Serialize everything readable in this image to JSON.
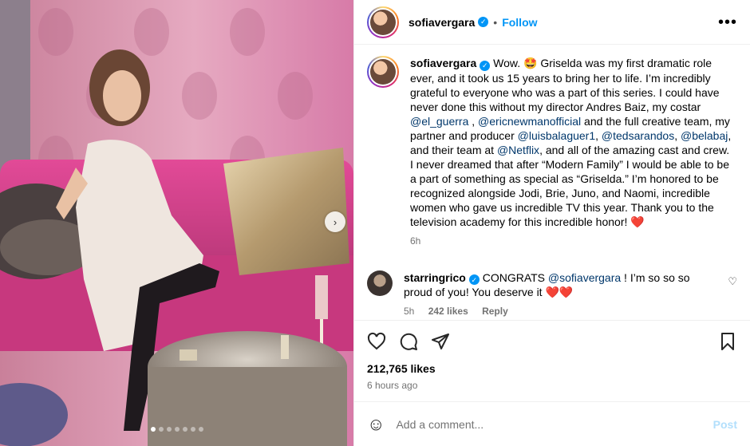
{
  "header": {
    "username": "sofiavergara",
    "separator": "•",
    "follow_label": "Follow",
    "more_label": "•••"
  },
  "caption": {
    "username": "sofiavergara",
    "text_before": "Wow. 🤩 Griselda was my first dramatic role ever, and it took us 15 years to bring her to life. I’m incredibly grateful to everyone who was a part of this series. I could have never done this without my director Andres Baiz, my costar ",
    "mention_1": "@el_guerra",
    "text_2": " , ",
    "mention_2": "@ericnewmanofficial",
    "text_3": " and the full creative team, my partner and producer ",
    "mention_3": "@luisbalaguer1",
    "text_4": ", ",
    "mention_4": "@tedsarandos",
    "text_5": ", ",
    "mention_5": "@belabaj",
    "text_6": ", and their team at ",
    "mention_6": "@Netflix",
    "text_7": ", and all of the amazing cast and crew. I never dreamed that after “Modern Family” I would be able to be a part of something as special as “Griselda.” I’m honored to be recognized alongside Jodi, Brie, Juno, and Naomi, incredible women who gave us incredible TV this year. Thank you to the television academy for this incredible honor! ",
    "heart": "❤️",
    "time": "6h"
  },
  "comment": {
    "username": "starringrico",
    "text_before": "CONGRATS ",
    "mention": "@sofiavergara",
    "text_after": " ! I’m so so so proud of you! You deserve it ",
    "hearts": "❤️❤️",
    "time": "5h",
    "likes": "242 likes",
    "reply_label": "Reply"
  },
  "stats": {
    "likes": "212,765 likes",
    "time_ago": "6 hours ago"
  },
  "add_comment": {
    "placeholder": "Add a comment...",
    "post_label": "Post"
  },
  "carousel": {
    "next_label": "›",
    "slide_count": 7,
    "active_index": 0
  },
  "colors": {
    "link": "#0095f6",
    "mention": "#00376b",
    "heart": "#ed4956",
    "post_disabled": "#b2dffc"
  }
}
